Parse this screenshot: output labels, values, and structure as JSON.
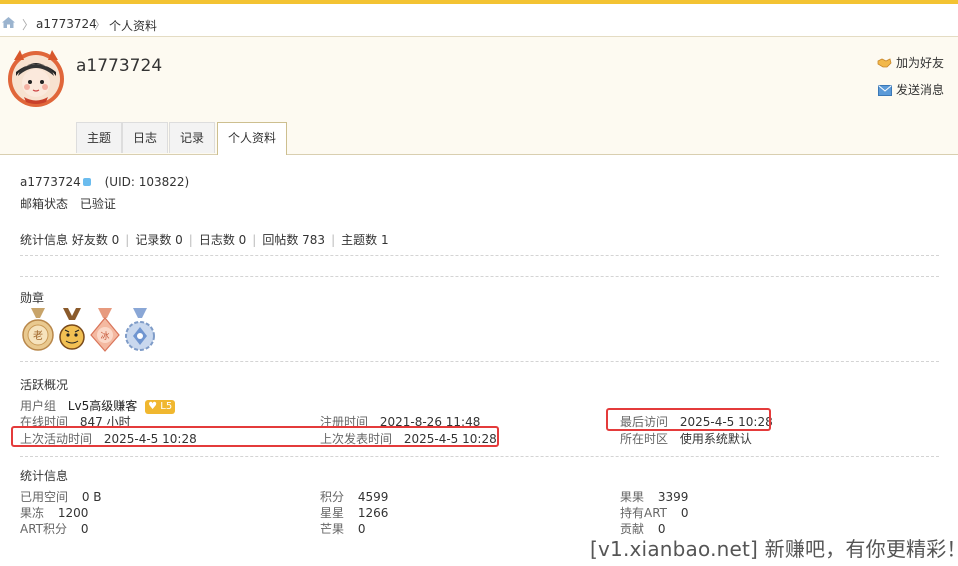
{
  "breadcrumb": {
    "user": "a1773724",
    "page": "个人资料"
  },
  "profile": {
    "username": "a1773724"
  },
  "actions": {
    "add_friend": "加为好友",
    "send_message": "发送消息"
  },
  "tabs": [
    "主题",
    "日志",
    "记录",
    "个人资料"
  ],
  "info": {
    "name": "a1773724",
    "uid": "(UID: 103822)",
    "email_label": "邮箱状态",
    "email_value": "已验证"
  },
  "stats_line": {
    "label": "统计信息",
    "items": [
      "好友数 0",
      "记录数 0",
      "日志数 0",
      "回帖数 783",
      "主题数 1"
    ]
  },
  "medals": {
    "title": "勋章"
  },
  "activity": {
    "title": "活跃概况",
    "group_label": "用户组",
    "group_value": "Lv5高级赚客",
    "level_badge": "L5",
    "online_label": "在线时间",
    "online_value": "847 小时",
    "register_label": "注册时间",
    "register_value": "2021-8-26 11:48",
    "last_visit_label": "最后访问",
    "last_visit_value": "2025-4-5 10:28",
    "last_active_label": "上次活动时间",
    "last_active_value": "2025-4-5 10:28",
    "last_post_label": "上次发表时间",
    "last_post_value": "2025-4-5 10:28",
    "timezone_label": "所在时区",
    "timezone_value": "使用系统默认"
  },
  "stats": {
    "title": "统计信息",
    "space_label": "已用空间",
    "space_value": "0 B",
    "points_label": "积分",
    "points_value": "4599",
    "fruit_label": "果果",
    "fruit_value": "3399",
    "jelly_label": "果冻",
    "jelly_value": "1200",
    "star_label": "星星",
    "star_value": "1266",
    "art_hold_label": "持有ART",
    "art_hold_value": "0",
    "art_points_label": "ART积分",
    "art_points_value": "0",
    "mango_label": "芒果",
    "mango_value": "0",
    "contrib_label": "贡献",
    "contrib_value": "0"
  },
  "watermark": "[v1.xianbao.net] 新赚吧，有你更精彩！",
  "colors": {
    "accent_bar": "#f3c332",
    "highlight_box": "#e43b3b",
    "level_badge": "#f0b72f"
  }
}
